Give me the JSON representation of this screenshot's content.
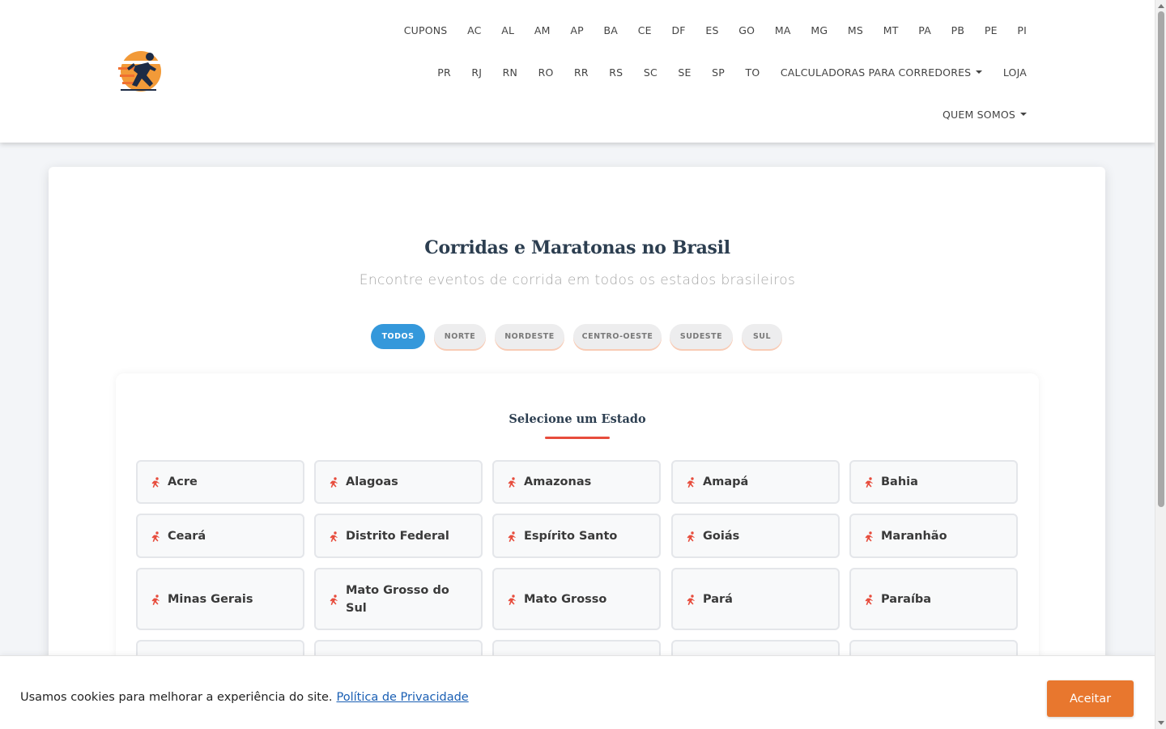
{
  "nav": {
    "row1": [
      "CUPONS",
      "AC",
      "AL",
      "AM",
      "AP",
      "BA",
      "CE",
      "DF",
      "ES",
      "GO",
      "MA",
      "MG",
      "MS",
      "MT",
      "PA",
      "PB",
      "PE",
      "PI"
    ],
    "row2": [
      "PR",
      "RJ",
      "RN",
      "RO",
      "RR",
      "RS",
      "SC",
      "SE",
      "SP",
      "TO"
    ],
    "calculators": "CALCULADORAS PARA CORREDORES",
    "store": "LOJA",
    "about": "QUEM SOMOS"
  },
  "hero": {
    "title": "Corridas e Maratonas no Brasil",
    "subtitle": "Encontre eventos de corrida em todos os estados brasileiros"
  },
  "filters": [
    "TODOS",
    "NORTE",
    "NORDESTE",
    "CENTRO-OESTE",
    "SUDESTE",
    "SUL"
  ],
  "active_filter": "TODOS",
  "section": {
    "title": "Selecione um Estado"
  },
  "states": [
    "Acre",
    "Alagoas",
    "Amazonas",
    "Amapá",
    "Bahia",
    "Ceará",
    "Distrito Federal",
    "Espírito Santo",
    "Goiás",
    "Maranhão",
    "Minas Gerais",
    "Mato Grosso do Sul",
    "Mato Grosso",
    "Pará",
    "Paraíba"
  ],
  "cookie": {
    "text": "Usamos cookies para melhorar a experiência do site.",
    "link": "Política de Privacidade",
    "accept": "Aceitar"
  },
  "colors": {
    "accent_blue": "#3498db",
    "accent_red": "#e74c3c",
    "accept_orange": "#e8772e",
    "title": "#2c3e50"
  },
  "icons": {
    "logo": "runner-sunset-logo",
    "state": "runner-icon"
  }
}
